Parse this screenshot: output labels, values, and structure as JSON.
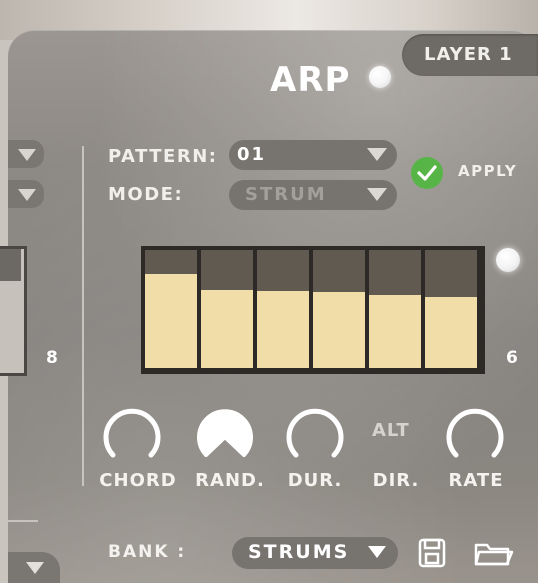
{
  "layer": {
    "label": "LAYER 1"
  },
  "arp": {
    "title": "ARP"
  },
  "pattern": {
    "label": "PATTERN:",
    "value": "01"
  },
  "mode": {
    "label": "MODE:",
    "value": "STRUM"
  },
  "apply": {
    "label": "APPLY"
  },
  "sequencer": {
    "min_label": "8",
    "max_label": "6",
    "steps": [
      0.8,
      0.66,
      0.65,
      0.64,
      0.62,
      0.6
    ]
  },
  "knobs": [
    {
      "label": "CHORD"
    },
    {
      "label": "RAND."
    },
    {
      "label": "DUR."
    },
    {
      "label": "DIR.",
      "alt_label": "ALT"
    },
    {
      "label": "RATE"
    }
  ],
  "bank": {
    "label": "BANK :",
    "value": "STRUMS"
  },
  "colors": {
    "panel": "#8c8883",
    "step_fill": "#f1dda7",
    "step_empty": "#605a51",
    "apply_green": "#57b548"
  },
  "icons": {
    "save": "save-icon",
    "folder": "folder-icon"
  }
}
